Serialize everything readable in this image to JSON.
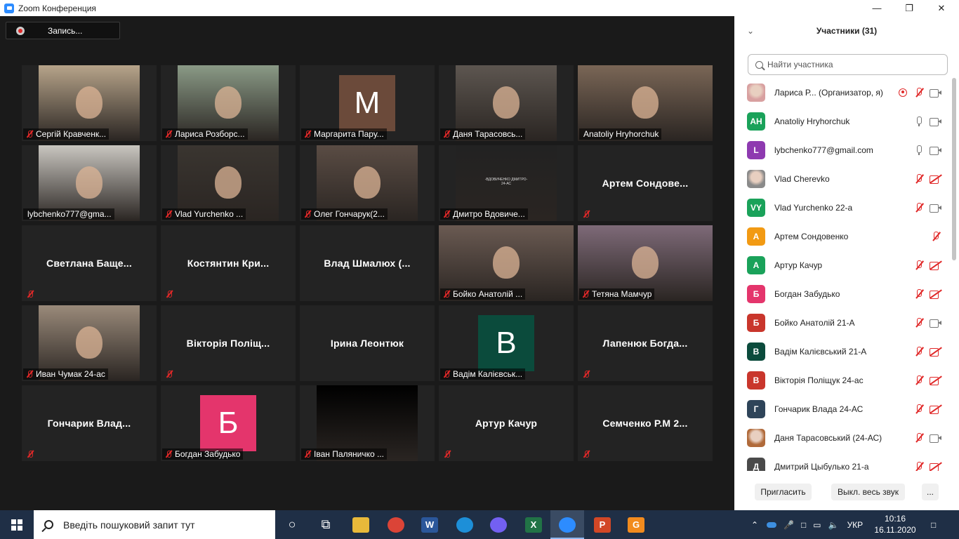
{
  "window": {
    "title": "Zoom Конференция",
    "controls": [
      "—",
      "❐",
      "✕"
    ]
  },
  "record_button": {
    "label": "Запись..."
  },
  "video_tiles": [
    {
      "name": "Сергій Кравченк...",
      "kind": "video",
      "muted": true,
      "color": "#b7a48a"
    },
    {
      "name": "Лариса Розборс...",
      "kind": "video",
      "muted": true,
      "color": "#8a9a86"
    },
    {
      "name": "Маргарита Пару...",
      "kind": "avatar",
      "letter": "M",
      "muted": true,
      "color": "#6b4a3a"
    },
    {
      "name": "Даня Тарасовсь...",
      "kind": "video",
      "muted": true,
      "color": "#5d5650"
    },
    {
      "name": "Anatoliy Hryhorchuk",
      "kind": "video",
      "muted": false,
      "active": true,
      "color": "#7a6656"
    },
    {
      "name": "lybchenko777@gma...",
      "kind": "video",
      "muted": false,
      "color": "#c9c6c0"
    },
    {
      "name": "Vlad Yurchenko ...",
      "kind": "video",
      "muted": true,
      "color": "#3a3530"
    },
    {
      "name": "Олег Гончарук(2...",
      "kind": "video",
      "muted": true,
      "color": "#5a4c44"
    },
    {
      "name": "Дмитро Вдовиче...",
      "kind": "video",
      "muted": true,
      "color": "#222222"
    },
    {
      "name": "Артем Сондове...",
      "kind": "name",
      "muted": true
    },
    {
      "name": "Светлана Баще...",
      "kind": "name",
      "muted": true
    },
    {
      "name": "Костянтин Кри...",
      "kind": "name",
      "muted": true
    },
    {
      "name": "Влад Шмалюх (...",
      "kind": "name",
      "muted": false
    },
    {
      "name": "Бойко Анатолій ...",
      "kind": "video",
      "muted": true,
      "wide": true,
      "color": "#6a5a52"
    },
    {
      "name": "Тетяна Мамчур",
      "kind": "video",
      "muted": true,
      "wide": true,
      "color": "#7e6a78"
    },
    {
      "name": "Иван Чумак 24-ас",
      "kind": "video",
      "muted": true,
      "color": "#9a8a7a"
    },
    {
      "name": "Вікторія Поліщ...",
      "kind": "name",
      "muted": true
    },
    {
      "name": "Ірина Леонтюк",
      "kind": "name",
      "muted": false
    },
    {
      "name": "Вадім Калієвськ...",
      "kind": "avatar",
      "letter": "B",
      "muted": true,
      "color": "#0b4b3c"
    },
    {
      "name": "Лапенюк Богда...",
      "kind": "name",
      "muted": true
    },
    {
      "name": "Гончарик Влад...",
      "kind": "name",
      "muted": true
    },
    {
      "name": "Богдан Забудько",
      "kind": "avatar",
      "letter": "Б",
      "muted": true,
      "color": "#e4356c"
    },
    {
      "name": "Іван Паляничко ...",
      "kind": "video",
      "muted": true,
      "color": "#000000"
    },
    {
      "name": "Артур Качур",
      "kind": "name",
      "muted": true
    },
    {
      "name": "Семченко Р.М 2...",
      "kind": "name",
      "muted": true
    }
  ],
  "tile_sublabel": "-ВДОВИЧЕНКО ДМИТРО-\n24-АС",
  "participants_panel": {
    "title": "Участники (31)",
    "search_placeholder": "Найти участника",
    "participants": [
      {
        "name": "Лариса Р...  (Организатор, я)",
        "avatar": "",
        "avatar_color": "#d8a0a0",
        "photo": true,
        "host": true,
        "mic": "off",
        "cam": "on"
      },
      {
        "name": "Anatoliy Hryhorchuk",
        "avatar": "AH",
        "avatar_color": "#1aa25a",
        "mic": "on",
        "cam": "on"
      },
      {
        "name": "lybchenko777@gmail.com",
        "avatar": "L",
        "avatar_color": "#8e3ab0",
        "mic": "on",
        "cam": "on"
      },
      {
        "name": "Vlad Cherevko",
        "avatar": "",
        "avatar_color": "#8a8a8a",
        "photo": true,
        "mic": "off",
        "cam": "off"
      },
      {
        "name": "Vlad Yurchenko 22-a",
        "avatar": "VY",
        "avatar_color": "#1aa25a",
        "mic": "off",
        "cam": "on"
      },
      {
        "name": "Артем Сондовенко",
        "avatar": "А",
        "avatar_color": "#f29a13",
        "mic": "off",
        "cam": "none"
      },
      {
        "name": "Артур Качур",
        "avatar": "А",
        "avatar_color": "#1aa25a",
        "mic": "off",
        "cam": "off"
      },
      {
        "name": "Богдан Забудько",
        "avatar": "Б",
        "avatar_color": "#e4356c",
        "mic": "off",
        "cam": "off"
      },
      {
        "name": "Бойко Анатолій 21-А",
        "avatar": "Б",
        "avatar_color": "#c9362c",
        "mic": "off",
        "cam": "on"
      },
      {
        "name": "Вадім Калієвський 21-А",
        "avatar": "В",
        "avatar_color": "#0b4b3c",
        "mic": "off",
        "cam": "off"
      },
      {
        "name": "Вікторія Поліщук 24-ас",
        "avatar": "В",
        "avatar_color": "#c9362c",
        "mic": "off",
        "cam": "off"
      },
      {
        "name": "Гончарик Влада 24-АС",
        "avatar": "Г",
        "avatar_color": "#2e4459",
        "mic": "off",
        "cam": "off"
      },
      {
        "name": "Даня Тарасовський (24-АС)",
        "avatar": "",
        "avatar_color": "#b06a3a",
        "photo": true,
        "mic": "off",
        "cam": "on"
      },
      {
        "name": "Дмитрий Цыбулько 21-а",
        "avatar": "Д",
        "avatar_color": "#4a4a4a",
        "mic": "off",
        "cam": "off"
      }
    ],
    "footer": {
      "invite": "Пригласить",
      "mute_all": "Выкл. весь звук",
      "more": "..."
    }
  },
  "taskbar": {
    "search_text": "Введіть пошуковий запит тут",
    "apps": [
      {
        "icon": "cortana-icon",
        "glyph": "○",
        "color": "transparent"
      },
      {
        "icon": "task-view-icon",
        "glyph": "⧉",
        "color": "transparent"
      },
      {
        "icon": "file-explorer-icon",
        "glyph": "",
        "color": "#e8b93a"
      },
      {
        "icon": "chrome-icon",
        "glyph": "",
        "color": "#db4437"
      },
      {
        "icon": "word-icon",
        "glyph": "W",
        "color": "#2b579a"
      },
      {
        "icon": "edge-icon",
        "glyph": "",
        "color": "#1d8fd8"
      },
      {
        "icon": "viber-icon",
        "glyph": "",
        "color": "#7360f2"
      },
      {
        "icon": "excel-icon",
        "glyph": "X",
        "color": "#217346"
      },
      {
        "icon": "zoom-icon",
        "glyph": "",
        "color": "#2d8cff",
        "active": true
      },
      {
        "icon": "powerpoint-icon",
        "glyph": "P",
        "color": "#d24726"
      },
      {
        "icon": "pdf-app-icon",
        "glyph": "G",
        "color": "#f28b1e"
      }
    ],
    "language": "УКР",
    "time": "10:16",
    "date": "16.11.2020"
  }
}
